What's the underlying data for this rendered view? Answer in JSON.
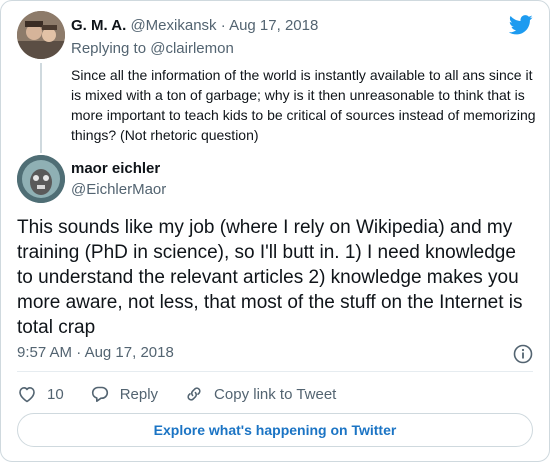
{
  "parent_tweet": {
    "author_name": "G. M. A.",
    "handle": "@Mexikansk",
    "separator": "·",
    "date": "Aug 17, 2018",
    "replying_to_prefix": "Replying to",
    "replying_to_handle": "@clairlemon",
    "text": "Since all the information of the world is instantly available to all ans since it is mixed with a ton of garbage; why is it then unreasonable to think that is more important to teach kids to be critical of sources instead of memorizing things? (Not rhetoric question)"
  },
  "main_tweet": {
    "author_name": "maor eichler",
    "handle": "@EichlerMaor",
    "text": "This sounds like my job (where I rely on Wikipedia) and my training (PhD in science), so I'll butt in. 1) I need knowledge to understand the relevant articles 2) knowledge makes you more aware, not less, that most of the stuff on the Internet is total crap",
    "time": "9:57 AM",
    "separator": "·",
    "date": "Aug 17, 2018"
  },
  "actions": {
    "like_count": "10",
    "reply_label": "Reply",
    "copy_link_label": "Copy link to Tweet"
  },
  "explore_label": "Explore what's happening on Twitter",
  "colors": {
    "brand": "#1d9bf0",
    "link": "#1b74c4",
    "secondary_text": "#536471",
    "border": "#cfd9de"
  },
  "icons": [
    "twitter-bird-icon",
    "info-icon",
    "heart-icon",
    "reply-icon",
    "link-icon"
  ]
}
